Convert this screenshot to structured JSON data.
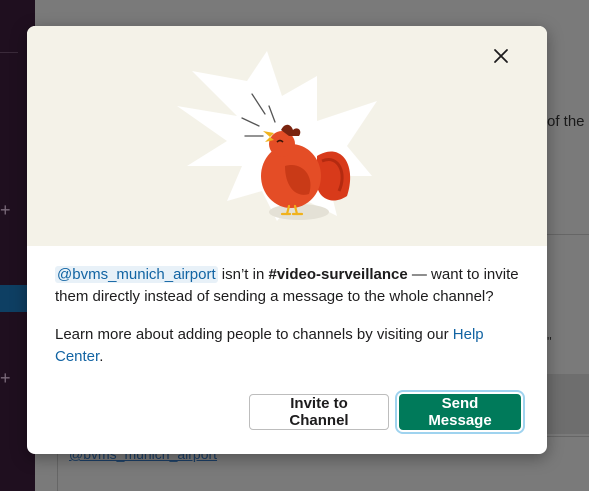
{
  "background": {
    "side_text": "of the",
    "quote_char": "\"",
    "composer_mention": "@bvms_munich_airport"
  },
  "modal": {
    "close_icon": "close-icon",
    "hero_icon": "rooster-illustration",
    "message": {
      "mention": "@bvms_munich_airport",
      "text_part1": " isn’t in ",
      "channel": "#video-surveillance",
      "text_part2": " — want to invite them directly instead of sending a message to the whole channel?"
    },
    "learn_more": {
      "text": "Learn more about adding people to channels by visiting our ",
      "link": "Help Center",
      "end": "."
    },
    "buttons": {
      "invite_label": "Invite to Channel",
      "send_label": "Send Message"
    }
  },
  "colors": {
    "primary": "#007a5a",
    "link": "#1264a3",
    "hero_bg": "#f4f2e8"
  }
}
